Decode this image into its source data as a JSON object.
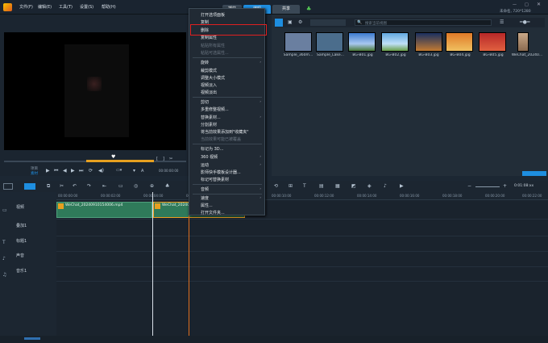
{
  "menubar": {
    "items": [
      "文件(F)",
      "编辑(E)",
      "工具(T)",
      "设置(S)",
      "帮助(H)"
    ],
    "tabs": [
      "捕获",
      "编辑",
      "共享"
    ],
    "right_info": "未命名, 720*1280"
  },
  "library": {
    "search_placeholder": "搜索当前视图",
    "items": [
      {
        "label": "Sample_360m...",
        "color": "#6a7fa0"
      },
      {
        "label": "Sample_Lake...",
        "color": "#4b6d8c"
      },
      {
        "label": "BG-B01.jpg",
        "color": "#3d7bd0"
      },
      {
        "label": "BG-B02.jpg",
        "color": "#62a8e0"
      },
      {
        "label": "BG-B03.jpg",
        "color": "#c27a32"
      },
      {
        "label": "BG-B04.jpg",
        "color": "#e07a28"
      },
      {
        "label": "BG-B05.jpg",
        "color": "#b82828"
      },
      {
        "label": "WeChat_20240..."
      }
    ]
  },
  "context_menu": {
    "items": [
      {
        "label": "打开选项面板",
        "enabled": true
      },
      {
        "label": "复制",
        "enabled": true
      },
      {
        "label": "删除",
        "enabled": true,
        "highlighted": true
      },
      {
        "label": "复制属性",
        "enabled": true
      },
      {
        "label": "粘贴所有属性",
        "enabled": false
      },
      {
        "label": "粘贴可选属性...",
        "enabled": false
      },
      {
        "label": "旋转",
        "enabled": true,
        "submenu": true
      },
      {
        "label": "裁剪模式",
        "enabled": true
      },
      {
        "label": "调整大小模式",
        "enabled": true
      },
      {
        "label": "视频淡入",
        "enabled": true
      },
      {
        "label": "视频淡出",
        "enabled": true
      },
      {
        "label": "剪切",
        "enabled": true,
        "submenu": true
      },
      {
        "label": "多重修整视频...",
        "enabled": true
      },
      {
        "label": "替换素材...",
        "enabled": true,
        "submenu": true
      },
      {
        "label": "分割素材",
        "enabled": true
      },
      {
        "label": "将当前效果添加到\"收藏夹\"",
        "enabled": true
      },
      {
        "label": "当前效果可能已被覆盖",
        "enabled": false
      },
      {
        "label": "标记为 3D...",
        "enabled": true
      },
      {
        "label": "360 视频",
        "enabled": true,
        "submenu": true
      },
      {
        "label": "运动",
        "enabled": true,
        "submenu": true
      },
      {
        "label": "影师快手模板设计器...",
        "enabled": true
      },
      {
        "label": "标记可替换素材",
        "enabled": true
      },
      {
        "label": "音频",
        "enabled": true,
        "submenu": true
      },
      {
        "label": "速度",
        "enabled": true,
        "submenu": true
      },
      {
        "label": "属性...",
        "enabled": true
      },
      {
        "label": "打开文件夹...",
        "enabled": true
      }
    ]
  },
  "preview": {
    "project_label": "项目",
    "clip_label": "素材",
    "zoom": "A",
    "timecode_left": "00:00:00:00",
    "timecode_right": "00:00:00:00"
  },
  "timeline": {
    "zoom_time": "0:01:08:xx",
    "ruler_ticks": [
      "00:00:00:00",
      "00:00:02:00",
      "00:00:04:00",
      "00:00:06:00",
      "00:00:08:00",
      "00:00:10:00",
      "00:00:12:00",
      "00:00:14:00",
      "00:00:16:00",
      "00:00:18:00",
      "00:00:20:00",
      "00:00:22:00"
    ],
    "tracks": [
      {
        "name": "视频",
        "sub": "叠加1",
        "icon": "video-icon"
      },
      {
        "name": "标题1",
        "icon": "title-icon"
      },
      {
        "name": "声音",
        "icon": "voice-icon"
      },
      {
        "name": "音乐1",
        "icon": "music-icon"
      }
    ],
    "clips": [
      {
        "label": "WeChat_20240910154006.mp4"
      },
      {
        "label": "WeChat_202409..."
      }
    ]
  }
}
